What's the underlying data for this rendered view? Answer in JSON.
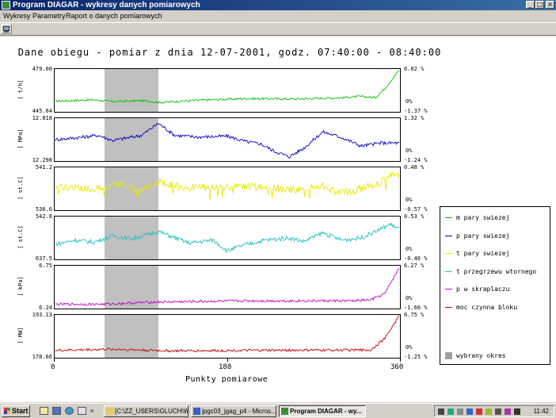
{
  "window": {
    "title": "Program DIAGAR - wykresy danych pomiarowych",
    "buttons": [
      "_",
      "□",
      "×"
    ]
  },
  "menu": [
    "Wykresy",
    "Parametry",
    "Raport o danych pomiarowych"
  ],
  "toolbar": {
    "icon": "chart-icon"
  },
  "chart_data": {
    "type": "line",
    "title": "Dane obiegu - pomiar z dnia 12-07-2001, godz. 07:40:00 - 08:40:00",
    "xlabel": "Punkty pomiarowe",
    "xlim": [
      0,
      360
    ],
    "xticks": [
      "0",
      "180",
      "360"
    ],
    "selected_range": [
      52,
      108
    ],
    "grid": false,
    "legend_position": "right",
    "series": [
      {
        "name": "m pary swiezej",
        "color": "#00c000",
        "unit": "[ t/h]",
        "ymax_label": "479.00",
        "ymin_label": "445.64",
        "r_top": "6.02 %",
        "r_zero": "0%",
        "r_bottom": "-1.37 %",
        "ymin": 0.12,
        "ymax": 0.98,
        "noise": 0.025,
        "points": [
          [
            0,
            0.25
          ],
          [
            40,
            0.28
          ],
          [
            60,
            0.24
          ],
          [
            90,
            0.26
          ],
          [
            110,
            0.22
          ],
          [
            150,
            0.27
          ],
          [
            200,
            0.31
          ],
          [
            250,
            0.3
          ],
          [
            300,
            0.33
          ],
          [
            320,
            0.36
          ],
          [
            335,
            0.33
          ],
          [
            345,
            0.55
          ],
          [
            360,
            0.97
          ]
        ]
      },
      {
        "name": "p pary swiezej",
        "color": "#0000c0",
        "unit": "[ MPa]",
        "ymax_label": "12.818",
        "ymin_label": "12.298",
        "r_top": "1.32 %",
        "r_zero": "0%",
        "r_bottom": "-1.24 %",
        "ymin": 0.05,
        "ymax": 0.98,
        "noise": 0.04,
        "points": [
          [
            0,
            0.5
          ],
          [
            25,
            0.55
          ],
          [
            45,
            0.6
          ],
          [
            60,
            0.48
          ],
          [
            90,
            0.6
          ],
          [
            108,
            0.88
          ],
          [
            125,
            0.6
          ],
          [
            150,
            0.56
          ],
          [
            180,
            0.58
          ],
          [
            200,
            0.45
          ],
          [
            215,
            0.4
          ],
          [
            230,
            0.22
          ],
          [
            245,
            0.1
          ],
          [
            260,
            0.3
          ],
          [
            280,
            0.68
          ],
          [
            300,
            0.55
          ],
          [
            320,
            0.35
          ],
          [
            340,
            0.42
          ],
          [
            360,
            0.42
          ]
        ]
      },
      {
        "name": "t pary swiezej",
        "color": "#e8e800",
        "unit": "[ st.C]",
        "ymax_label": "541.2",
        "ymin_label": "536.6",
        "r_top": "0.48 %",
        "r_zero": "0%",
        "r_bottom": "-0.57 %",
        "ymin": 0.12,
        "ymax": 0.92,
        "noise": 0.09,
        "points": [
          [
            0,
            0.55
          ],
          [
            30,
            0.5
          ],
          [
            50,
            0.52
          ],
          [
            70,
            0.6
          ],
          [
            90,
            0.45
          ],
          [
            108,
            0.65
          ],
          [
            130,
            0.55
          ],
          [
            160,
            0.52
          ],
          [
            200,
            0.55
          ],
          [
            250,
            0.48
          ],
          [
            280,
            0.58
          ],
          [
            300,
            0.42
          ],
          [
            320,
            0.5
          ],
          [
            340,
            0.65
          ],
          [
            350,
            0.82
          ],
          [
            360,
            0.78
          ]
        ]
      },
      {
        "name": "t przegrzewu wtornego",
        "color": "#20c0c0",
        "unit": "[ st.C]",
        "ymax_label": "542.8",
        "ymin_label": "637.5",
        "r_top": "0.53 %",
        "r_zero": "0%",
        "r_bottom": "-0.46 %",
        "ymin": 0.1,
        "ymax": 0.92,
        "noise": 0.05,
        "points": [
          [
            0,
            0.35
          ],
          [
            20,
            0.45
          ],
          [
            40,
            0.4
          ],
          [
            60,
            0.55
          ],
          [
            80,
            0.48
          ],
          [
            108,
            0.65
          ],
          [
            140,
            0.38
          ],
          [
            165,
            0.45
          ],
          [
            180,
            0.2
          ],
          [
            200,
            0.35
          ],
          [
            220,
            0.45
          ],
          [
            245,
            0.5
          ],
          [
            260,
            0.42
          ],
          [
            280,
            0.62
          ],
          [
            300,
            0.45
          ],
          [
            320,
            0.5
          ],
          [
            340,
            0.7
          ],
          [
            350,
            0.82
          ],
          [
            360,
            0.72
          ]
        ]
      },
      {
        "name": "p w skraplaczu",
        "color": "#c000c0",
        "unit": "[ kPa]",
        "ymax_label": "6.75",
        "ymin_label": "6.24",
        "r_top": "6.27 %",
        "r_zero": "0%",
        "r_bottom": "-1.66 %",
        "ymin": 0.02,
        "ymax": 0.98,
        "noise": 0.03,
        "points": [
          [
            0,
            0.1
          ],
          [
            50,
            0.1
          ],
          [
            100,
            0.15
          ],
          [
            200,
            0.18
          ],
          [
            310,
            0.18
          ],
          [
            330,
            0.2
          ],
          [
            345,
            0.35
          ],
          [
            360,
            0.95
          ]
        ]
      },
      {
        "name": "moc czynna bloku",
        "color": "#c00000",
        "unit": "[ MW]",
        "ymax_label": "193.13",
        "ymin_label": "178.66",
        "r_top": "6.75 %",
        "r_zero": "0%",
        "r_bottom": "-1.25 %",
        "ymin": 0.02,
        "ymax": 0.98,
        "noise": 0.03,
        "points": [
          [
            0,
            0.17
          ],
          [
            60,
            0.2
          ],
          [
            120,
            0.16
          ],
          [
            200,
            0.17
          ],
          [
            300,
            0.18
          ],
          [
            330,
            0.18
          ],
          [
            345,
            0.45
          ],
          [
            360,
            0.98
          ]
        ]
      }
    ],
    "legend_selected_label": "wybrany okres"
  },
  "taskbar": {
    "start_label": "Start",
    "tasks": [
      "[C:\\ZZ_USERS\\GLUCH\\W...",
      "jpgc03_jgag_p4 - Micros...",
      "Program DIAGAR - wy..."
    ],
    "clock": "11:42"
  },
  "colors": {
    "titlebar": "#0a246a",
    "selection": "#c0c0c0",
    "background": "#ffffff"
  }
}
